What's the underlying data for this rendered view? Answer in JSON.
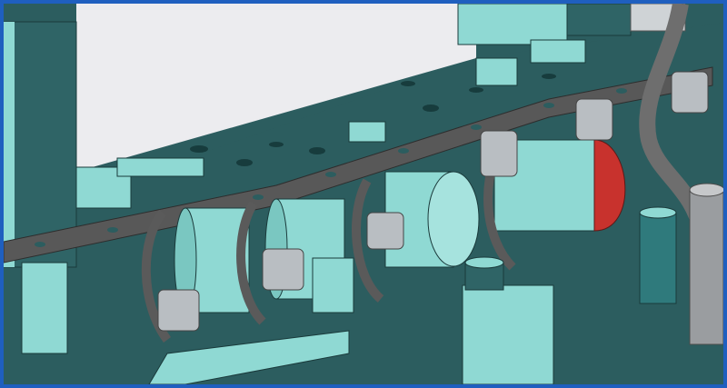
{
  "viewport": {
    "name": "cad-3d-viewport",
    "background_colors": {
      "sky": "#ececef",
      "base_plate": "#2c5d5f",
      "block": "#8fd9d3",
      "strip": "#6e6e6e",
      "highlight": "#c8322d",
      "frame": "#1f5fbf"
    }
  }
}
